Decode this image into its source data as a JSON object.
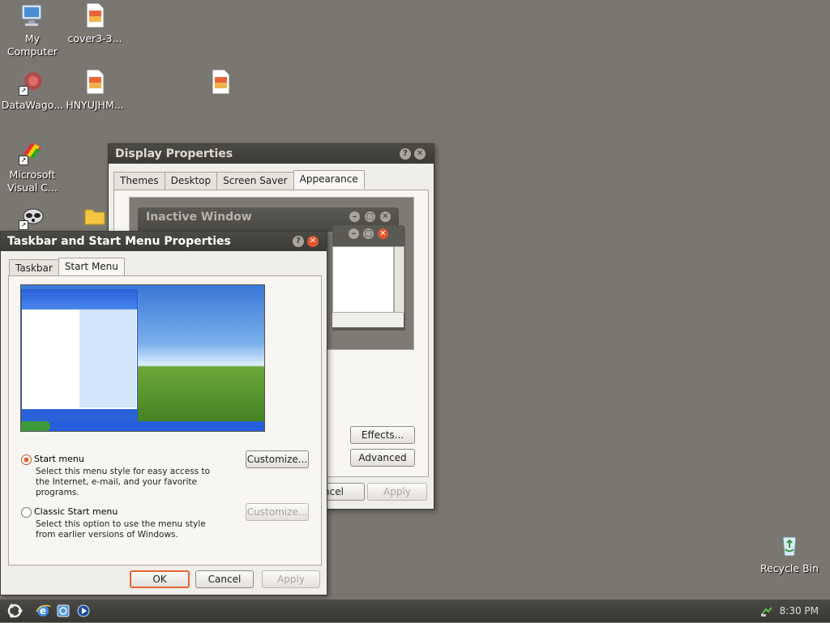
{
  "desktop": {
    "icons": [
      {
        "name": "my-computer",
        "label": "My\nComputer"
      },
      {
        "name": "cover3-file",
        "label": "cover3-3..."
      },
      {
        "name": "datawagon",
        "label": "DataWago..."
      },
      {
        "name": "hnyujhm-file",
        "label": "HNYUJHM..."
      },
      {
        "name": "microsoft-visual-c",
        "label": "Microsoft\nVisual C..."
      },
      {
        "name": "recycle-bin",
        "label": "Recycle Bin"
      }
    ]
  },
  "display_properties": {
    "title": "Display Properties",
    "tabs": [
      "Themes",
      "Desktop",
      "Screen Saver",
      "Appearance"
    ],
    "selected_tab": "Appearance",
    "preview": {
      "inactive_title": "Inactive Window"
    },
    "effects_label": "Effects...",
    "advanced_label": "Advanced",
    "cancel_partial_label": "ncel",
    "apply_label": "Apply"
  },
  "taskbar_props": {
    "title": "Taskbar and Start Menu Properties",
    "tabs": [
      "Taskbar",
      "Start Menu"
    ],
    "selected_tab": "Start Menu",
    "option1": {
      "label": "Start menu",
      "desc": "Select this menu style for easy access to the Internet, e-mail, and your favorite programs.",
      "selected": true
    },
    "option2": {
      "label": "Classic Start menu",
      "desc": "Select this option to use the menu style from earlier versions of Windows.",
      "selected": false
    },
    "customize_label": "Customize...",
    "ok_label": "OK",
    "cancel_label": "Cancel",
    "apply_label": "Apply"
  },
  "taskbar": {
    "time": "8:30 PM"
  }
}
